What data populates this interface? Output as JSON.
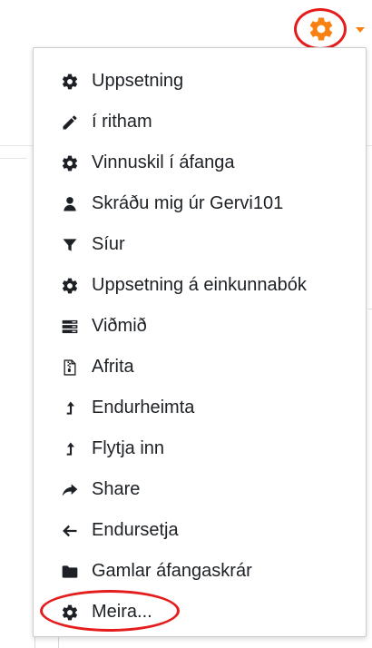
{
  "colors": {
    "accent": "#f98012",
    "highlight_ring": "#e41c1c",
    "text": "#1d2125",
    "icon": "#1d2125"
  },
  "trigger": {
    "icon": "gear-icon",
    "caret_icon": "caret-down-icon"
  },
  "menu": {
    "items": [
      {
        "label": "Uppsetning",
        "icon": "gear-icon"
      },
      {
        "label": "í ritham",
        "icon": "pencil-icon"
      },
      {
        "label": "Vinnuskil í áfanga",
        "icon": "gear-icon"
      },
      {
        "label": "Skráðu mig úr Gervi101",
        "icon": "user-icon"
      },
      {
        "label": "Síur",
        "icon": "filter-icon"
      },
      {
        "label": "Uppsetning á einkunnabók",
        "icon": "gear-icon"
      },
      {
        "label": "Viðmið",
        "icon": "server-icon"
      },
      {
        "label": "Afrita",
        "icon": "file-archive-icon"
      },
      {
        "label": "Endurheimta",
        "icon": "level-up-icon"
      },
      {
        "label": "Flytja inn",
        "icon": "level-up-icon"
      },
      {
        "label": "Share",
        "icon": "share-icon"
      },
      {
        "label": "Endursetja",
        "icon": "arrow-left-icon"
      },
      {
        "label": "Gamlar áfangaskrár",
        "icon": "folder-icon"
      },
      {
        "label": "Meira...",
        "icon": "gear-icon"
      }
    ]
  }
}
